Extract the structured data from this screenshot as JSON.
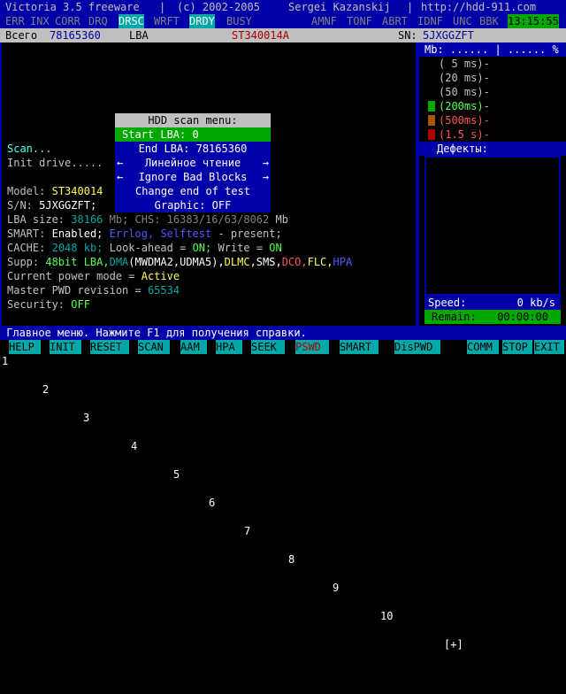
{
  "title_bar": {
    "app": "Victoria 3.5 freeware",
    "copyright": "(c) 2002-2005",
    "author": "Sergei Kazanskij",
    "url": "http://hdd-911.com",
    "sep": "|"
  },
  "flags_left": [
    "ERR",
    "INX",
    "CORR",
    "DRQ",
    "DRSC",
    "WRFT",
    "DRDY",
    "BUSY"
  ],
  "flags_right": [
    "AMNF",
    "TONF",
    "ABRT",
    "IDNF",
    "UNC",
    "BBK"
  ],
  "clock": "13:15:55",
  "info": {
    "total_label": "Всего",
    "total_value": "78165360",
    "lba_label": "LBA",
    "model": "ST340014A",
    "sn_label": "SN:",
    "sn_value": "5JXGGZFT"
  },
  "console": {
    "scan": "Scan...",
    "init": "Init drive.....",
    "model_label": "Model:",
    "model_value": "ST340014",
    "sn_label": "S/N:",
    "sn_value": "5JXGGZFT;",
    "lba_size_label": "LBA size:",
    "lba_size_value": "38166",
    "lba_size_unit": "Mb; CHS:",
    "chs_value": "16383/16/63/8062",
    "chs_unit": "Mb",
    "smart_label": "SMART:",
    "smart_enabled": "Enabled;",
    "smart_errlog": "Errlog,",
    "smart_selftest": "Selftest",
    "smart_present": "- present;",
    "cache_label": "CACHE:",
    "cache_value": "2048 kb;",
    "lookahead_label": "Look-ahead =",
    "lookahead_value": "ON;",
    "write_label": "Write =",
    "write_value": "ON",
    "supp_label": "Supp:",
    "supp_48bit": "48bit LBA,",
    "supp_dma": "DMA",
    "supp_dma_modes": "(MWDMA2,UDMA5),",
    "supp_dlmc": "DLMC,",
    "supp_sms": "SMS,",
    "supp_dco": "DCO,",
    "supp_flc": "FLC,",
    "supp_hpa": "HPA",
    "power_label": "Current power mode =",
    "power_value": "Active",
    "pwd_label": "Master PWD revision =",
    "pwd_value": "65534",
    "security_label": "Security:",
    "security_value": "OFF"
  },
  "menu": {
    "title": "HDD scan menu:",
    "items": [
      "Start LBA:  0",
      "End LBA: 78165360",
      "Линейное чтение",
      "Ignore Bad Blocks",
      "Change end of test",
      "Graphic: OFF"
    ],
    "arrow_left": "←",
    "arrow_right": "→"
  },
  "right_panel": {
    "mb_header": "Mb: ......  | ...... %",
    "legend": [
      {
        "label": "( 5 ms)-",
        "color": "#000000"
      },
      {
        "label": "(20 ms)-",
        "color": "#000000"
      },
      {
        "label": "(50 ms)-",
        "color": "#000000"
      },
      {
        "label": "(200ms)-",
        "color": "#00a800"
      },
      {
        "label": "(500ms)-",
        "color": "#a85400"
      },
      {
        "label": "(1.5 s)-",
        "color": "#a80000"
      }
    ],
    "defects_label": "Дефекты:",
    "speed_label": "Speed:",
    "speed_value": "0 kb/s",
    "remain_label": "Remain:",
    "remain_value": "00:00:00"
  },
  "help_bar": " Главное меню. Нажмите F1 для получения справки.",
  "function_keys": [
    {
      "num": "1",
      "label": "HELP"
    },
    {
      "num": "2",
      "label": "INIT"
    },
    {
      "num": "3",
      "label": "RESET"
    },
    {
      "num": "4",
      "label": "SCAN"
    },
    {
      "num": "5",
      "label": "AAM"
    },
    {
      "num": "6",
      "label": "HPA"
    },
    {
      "num": "7",
      "label": "SEEK"
    },
    {
      "num": "8",
      "label": "PSWD"
    },
    {
      "num": "9",
      "label": "SMART"
    },
    {
      "num": "10",
      "label": "DisPWD"
    },
    {
      "num": "[+]",
      "label": "COMM"
    },
    {
      "num": "",
      "label": "STOP"
    },
    {
      "num": "",
      "label": "EXIT"
    }
  ],
  "colors": {
    "window_blue": "#0000a8",
    "active_flag": "#00a8a8",
    "clock_green": "#00a800",
    "selection_green": "#00a800"
  }
}
